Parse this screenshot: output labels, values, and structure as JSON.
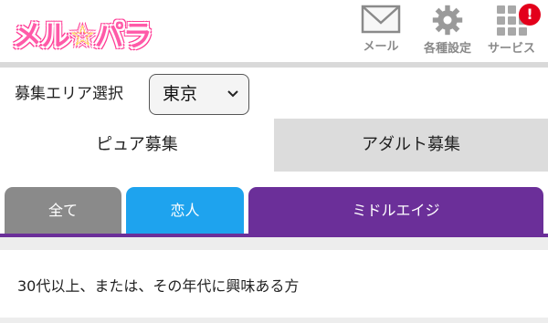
{
  "header": {
    "logo_text_a": "メル",
    "logo_star": "☆",
    "logo_text_b": "パラ",
    "nav": [
      {
        "label": "メール",
        "icon": "mail-icon"
      },
      {
        "label": "各種設定",
        "icon": "gear-icon"
      },
      {
        "label": "サービス",
        "icon": "grid-icon",
        "badge": "!"
      }
    ]
  },
  "area": {
    "label": "募集エリア選択",
    "selected": "東京"
  },
  "tabs": {
    "pure": "ピュア募集",
    "adult": "アダルト募集"
  },
  "subtabs": {
    "all": "全て",
    "lover": "恋人",
    "middle": "ミドルエイジ"
  },
  "description": "30代以上、または、その年代に興味ある方",
  "colors": {
    "brand_pink": "#ff5aa8",
    "purple": "#6b2f99",
    "blue": "#1ea3ee",
    "gray_tab": "#8a8a8a",
    "badge_red": "#e3001b"
  }
}
